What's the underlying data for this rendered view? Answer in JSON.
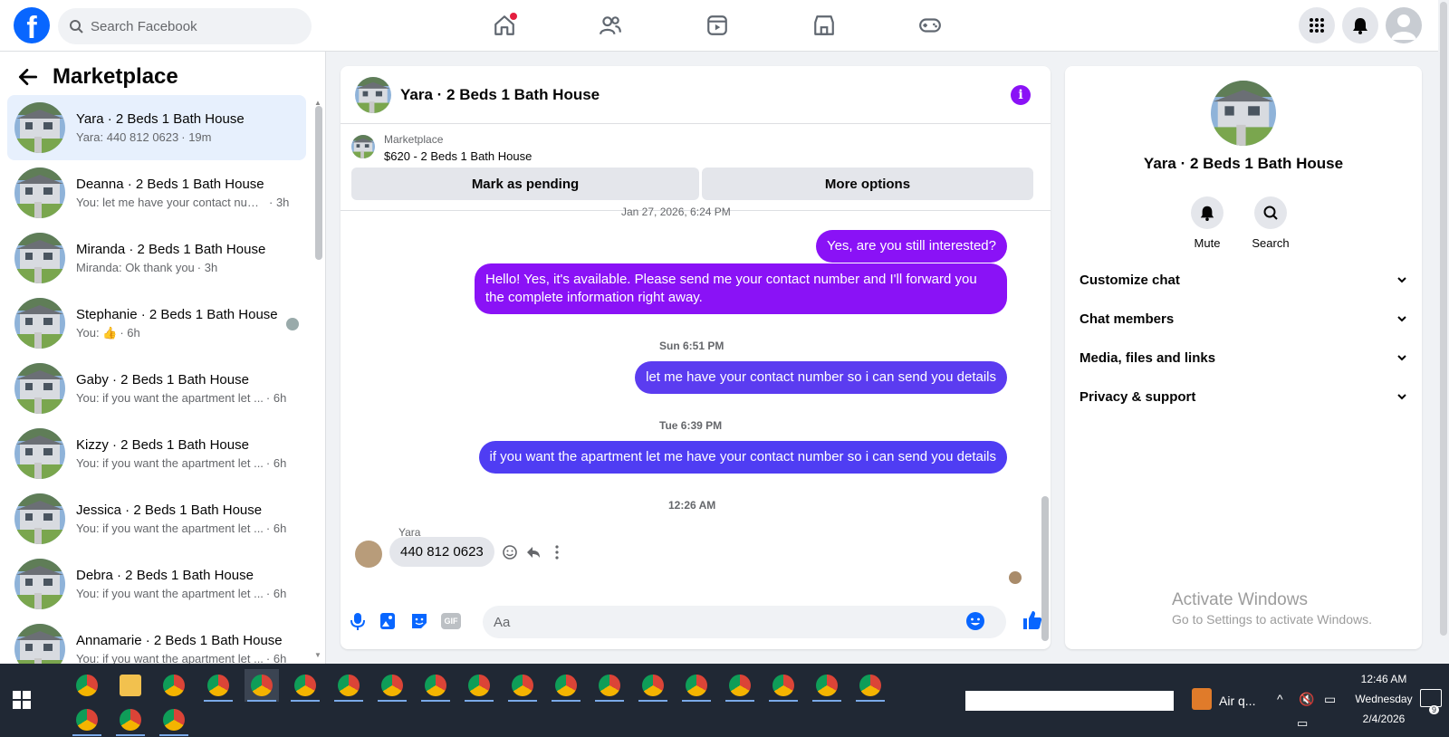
{
  "topbar": {
    "logo": "f",
    "search_placeholder": "Search Facebook",
    "icons": [
      "home-icon",
      "friends-icon",
      "video-icon",
      "marketplace-icon",
      "gaming-icon",
      "menu-grid-icon",
      "bell-icon",
      "profile-avatar"
    ]
  },
  "sidebar": {
    "title": "Marketplace",
    "conversations": [
      {
        "name": "Yara · 2 Beds 1 Bath House",
        "preview": "Yara: 440 812 0623",
        "time": "· 19m",
        "active": true
      },
      {
        "name": "Deanna · 2 Beds 1 Bath House",
        "preview": "You: let me have your contact num...",
        "time": "· 3h"
      },
      {
        "name": "Miranda · 2 Beds 1 Bath House",
        "preview": "Miranda: Ok thank you",
        "time": "· 3h"
      },
      {
        "name": "Stephanie · 2 Beds 1 Bath House",
        "preview": "You: 👍",
        "time": "· 6h"
      },
      {
        "name": "Gaby · 2 Beds 1 Bath House",
        "preview": "You: if you want the apartment let ...",
        "time": "· 6h"
      },
      {
        "name": "Kizzy · 2 Beds 1 Bath House",
        "preview": "You: if you want the apartment let ...",
        "time": "· 6h"
      },
      {
        "name": "Jessica · 2 Beds 1 Bath House",
        "preview": "You: if you want the apartment let ...",
        "time": "· 6h"
      },
      {
        "name": "Debra · 2 Beds 1 Bath House",
        "preview": "You: if you want the apartment let ...",
        "time": "· 6h"
      },
      {
        "name": "Annamarie · 2 Beds 1 Bath House",
        "preview": "You: if you want the apartment let ...",
        "time": "· 6h"
      }
    ]
  },
  "chat": {
    "title": "Yara · 2 Beds 1 Bath House",
    "info_glyph": "i",
    "marketplace_label": "Marketplace",
    "listing": "$620 - 2 Beds 1 Bath House",
    "mark_pending": "Mark as pending",
    "more_options": "More options",
    "cut_timestamp": "Jan 27, 2026, 6:24 PM",
    "messages": {
      "m1": "Yes, are you still interested?",
      "m2": "Hello! Yes, it's available. Please send me your contact number and I'll forward you the complete information right away.",
      "ts1": "Sun 6:51 PM",
      "m3": "let me have your contact number so i can send you details",
      "ts2": "Tue 6:39 PM",
      "m4": "if you want the apartment let me have your contact number so i can send you details",
      "ts3": "12:26 AM",
      "sender": "Yara",
      "reply": "440 812 0623"
    },
    "composer_placeholder": "Aa",
    "gif_label": "GIF"
  },
  "info_panel": {
    "name": "Yara · 2 Beds 1 Bath House",
    "mute": "Mute",
    "search": "Search",
    "rows": [
      "Customize chat",
      "Chat members",
      "Media, files and links",
      "Privacy & support"
    ]
  },
  "watermark": {
    "line1": "Activate Windows",
    "line2": "Go to Settings to activate Windows."
  },
  "taskbar": {
    "weather": "Air q...",
    "time": "12:46 AM",
    "day": "Wednesday",
    "date": "2/4/2026",
    "notif_count": "9"
  },
  "colors": {
    "brand": "#0866ff",
    "bubble_purple": "#8a12f6",
    "bubble_blue": "#5b3cf0",
    "taskbar": "#202834"
  }
}
